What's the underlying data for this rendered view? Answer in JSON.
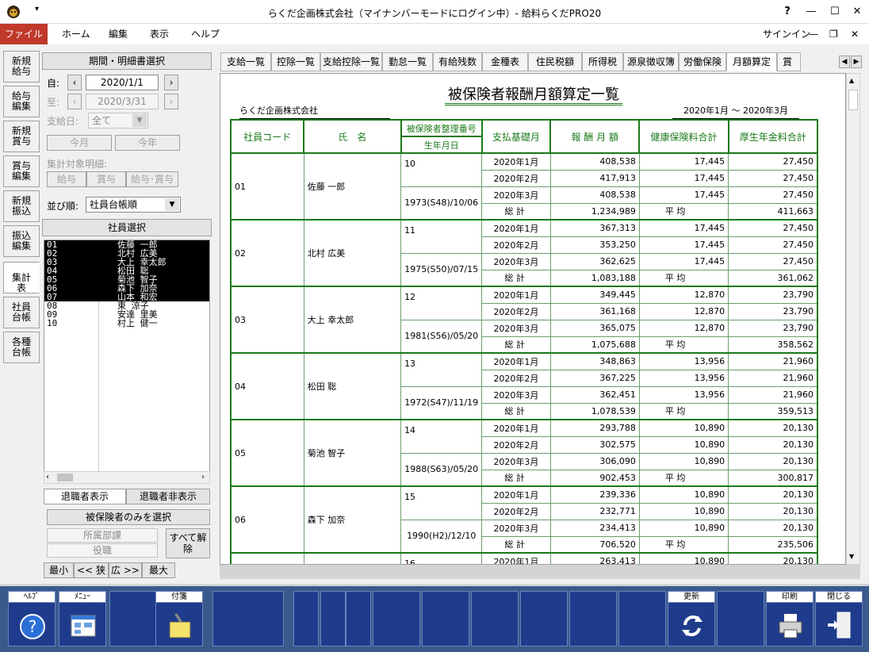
{
  "window": {
    "title": "らくだ企画株式会社（マイナンバーモードにログイン中）- 給料らくだPRO20",
    "help_glyph": "?",
    "minimize_glyph": "—",
    "maximize_glyph": "☐",
    "close_glyph": "✕"
  },
  "menu": {
    "file": "ファイル",
    "home": "ホーム",
    "edit": "編集",
    "view": "表示",
    "help": "ヘルプ",
    "signin": "サインイン"
  },
  "vtabs": [
    "新規給与",
    "給与編集",
    "新規賞与",
    "賞与編集",
    "新規振込",
    "振込編集",
    "集計表",
    "社員台帳",
    "各種台帳"
  ],
  "left": {
    "period_header": "期間・明細書選択",
    "from_label": "自:",
    "from_value": "2020/1/1",
    "to_label": "至:",
    "to_value": "2020/3/31",
    "payday_label": "支給日:",
    "payday_value": "全て",
    "this_month": "今月",
    "this_year": "今年",
    "target_label": "集計対象明細:",
    "t_salary": "給与",
    "t_bonus": "賞与",
    "t_both": "給与･賞与",
    "sort_label": "並び順:",
    "sort_value": "社員台帳順",
    "emp_header": "社員選択",
    "employees": [
      {
        "code": "01",
        "name": "佐藤 一郎",
        "sel": true
      },
      {
        "code": "02",
        "name": "北村 広美",
        "sel": true
      },
      {
        "code": "03",
        "name": "大上 幸太郎",
        "sel": true
      },
      {
        "code": "04",
        "name": "松田 聡",
        "sel": true
      },
      {
        "code": "05",
        "name": "菊池 智子",
        "sel": true
      },
      {
        "code": "06",
        "name": "森下 加奈",
        "sel": true
      },
      {
        "code": "07",
        "name": "山本 和宏",
        "sel": true
      },
      {
        "code": "08",
        "name": "東 涼子",
        "sel": false
      },
      {
        "code": "09",
        "name": "安達 里美",
        "sel": false
      },
      {
        "code": "10",
        "name": "村上 健一",
        "sel": false
      }
    ],
    "retired_show": "退職者表示",
    "retired_hide": "退職者非表示",
    "insured_only": "被保険者のみを選択",
    "dept": "所属部課",
    "position": "役職",
    "clear_all": "すべて解除",
    "zoom_min": "最小",
    "zoom_narrow": "<< 狭",
    "zoom_wide": "広 >>",
    "zoom_max": "最大"
  },
  "tabs": [
    "支給一覧",
    "控除一覧",
    "支給控除一覧",
    "勤怠一覧",
    "有給残数",
    "金種表",
    "住民税額",
    "所得税",
    "源泉徴収簿",
    "労働保険",
    "月額算定",
    "賞与"
  ],
  "active_tab": "月額算定",
  "report": {
    "title": "被保険者報酬月額算定一覧",
    "company": "らくだ企画株式会社",
    "period": "2020年1月 〜 2020年3月",
    "headers": {
      "code": "社員コード",
      "name": "氏　名",
      "insno": "被保険者整理番号",
      "birth": "生年月日",
      "base": "支払基礎月",
      "pay": "報 酬 月 額",
      "health": "健康保険料合計",
      "pension": "厚生年金料合計"
    },
    "total_label": "総 計",
    "avg_label": "平 均",
    "employees": [
      {
        "code": "01",
        "name": "佐藤 一郎",
        "insno": "10",
        "birth": "1973(S48)/10/06",
        "months": [
          {
            "m": "2020年1月",
            "pay": "408,538",
            "health": "17,445",
            "pension": "27,450"
          },
          {
            "m": "2020年2月",
            "pay": "417,913",
            "health": "17,445",
            "pension": "27,450"
          },
          {
            "m": "2020年3月",
            "pay": "408,538",
            "health": "17,445",
            "pension": "27,450"
          }
        ],
        "total": "1,234,989",
        "avg": "411,663"
      },
      {
        "code": "02",
        "name": "北村 広美",
        "insno": "11",
        "birth": "1975(S50)/07/15",
        "months": [
          {
            "m": "2020年1月",
            "pay": "367,313",
            "health": "17,445",
            "pension": "27,450"
          },
          {
            "m": "2020年2月",
            "pay": "353,250",
            "health": "17,445",
            "pension": "27,450"
          },
          {
            "m": "2020年3月",
            "pay": "362,625",
            "health": "17,445",
            "pension": "27,450"
          }
        ],
        "total": "1,083,188",
        "avg": "361,062"
      },
      {
        "code": "03",
        "name": "大上 幸太郎",
        "insno": "12",
        "birth": "1981(S56)/05/20",
        "months": [
          {
            "m": "2020年1月",
            "pay": "349,445",
            "health": "12,870",
            "pension": "23,790"
          },
          {
            "m": "2020年2月",
            "pay": "361,168",
            "health": "12,870",
            "pension": "23,790"
          },
          {
            "m": "2020年3月",
            "pay": "365,075",
            "health": "12,870",
            "pension": "23,790"
          }
        ],
        "total": "1,075,688",
        "avg": "358,562"
      },
      {
        "code": "04",
        "name": "松田 聡",
        "insno": "13",
        "birth": "1972(S47)/11/19",
        "months": [
          {
            "m": "2020年1月",
            "pay": "348,863",
            "health": "13,956",
            "pension": "21,960"
          },
          {
            "m": "2020年2月",
            "pay": "367,225",
            "health": "13,956",
            "pension": "21,960"
          },
          {
            "m": "2020年3月",
            "pay": "362,451",
            "health": "13,956",
            "pension": "21,960"
          }
        ],
        "total": "1,078,539",
        "avg": "359,513"
      },
      {
        "code": "05",
        "name": "菊池 智子",
        "insno": "14",
        "birth": "1988(S63)/05/20",
        "months": [
          {
            "m": "2020年1月",
            "pay": "293,788",
            "health": "10,890",
            "pension": "20,130"
          },
          {
            "m": "2020年2月",
            "pay": "302,575",
            "health": "10,890",
            "pension": "20,130"
          },
          {
            "m": "2020年3月",
            "pay": "306,090",
            "health": "10,890",
            "pension": "20,130"
          }
        ],
        "total": "902,453",
        "avg": "300,817"
      },
      {
        "code": "06",
        "name": "森下 加奈",
        "insno": "15",
        "birth": "1990(H2)/12/10",
        "months": [
          {
            "m": "2020年1月",
            "pay": "239,336",
            "health": "10,890",
            "pension": "20,130"
          },
          {
            "m": "2020年2月",
            "pay": "232,771",
            "health": "10,890",
            "pension": "20,130"
          },
          {
            "m": "2020年3月",
            "pay": "234,413",
            "health": "10,890",
            "pension": "20,130"
          }
        ],
        "total": "706,520",
        "avg": "235,506"
      },
      {
        "code": "",
        "name": "",
        "insno": "16",
        "birth": "",
        "months": [
          {
            "m": "2020年1月",
            "pay": "263,413",
            "health": "10,890",
            "pension": "20,130"
          }
        ],
        "total": "",
        "avg": ""
      }
    ]
  },
  "fkeys": {
    "help": "ﾍﾙﾌﾟ",
    "menu": "ﾒﾆｭｰ",
    "tag": "付箋",
    "refresh": "更新",
    "print": "印刷",
    "close": "閉じる"
  },
  "colors": {
    "accent_red": "#c0392b",
    "grid_green": "#1a7a1a",
    "fkey_blue": "#1f3c8c"
  }
}
